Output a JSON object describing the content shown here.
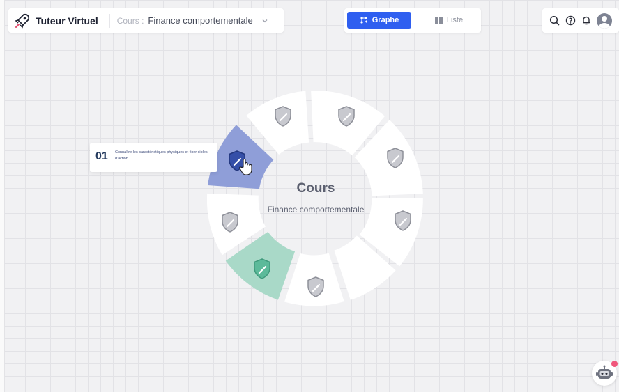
{
  "header": {
    "app_title": "Tuteur Virtuel",
    "course_prefix": "Cours :",
    "course_name": "Finance comportementale"
  },
  "view_toggle": {
    "graph_label": "Graphe",
    "list_label": "Liste",
    "active": "Graphe"
  },
  "center": {
    "title": "Cours",
    "subtitle": "Finance comportementale"
  },
  "tooltip": {
    "number": "01",
    "text": "Connaître les caractéristiques physiques et fixer cibles d'action"
  },
  "colors": {
    "accent": "#2f5ff0",
    "segment_active": "#8f9ed8",
    "segment_done": "#a9d9c8",
    "segment_default": "#ffffff"
  }
}
